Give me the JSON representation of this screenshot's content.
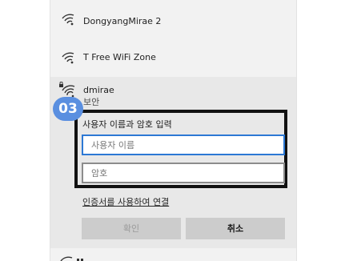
{
  "networks": [
    {
      "name": "DongyangMirae 2",
      "icon": "wifi-icon",
      "secured": false
    },
    {
      "name": "T Free WiFi Zone",
      "icon": "wifi-icon",
      "secured": false
    },
    {
      "name": "dmirae",
      "icon": "wifi-secured-icon",
      "secured": true,
      "status": "보안"
    }
  ],
  "step_badge": "03",
  "auth": {
    "prompt": "사용자 이름과 암호 입력",
    "username_placeholder": "사용자 이름",
    "username_value": "",
    "password_placeholder": "암호",
    "password_value": "",
    "cert_link": "인증서를 사용하여 연결",
    "ok_label": "확인",
    "cancel_label": "취소"
  },
  "colors": {
    "accent": "#2c78d4",
    "badge": "#5a8fe0",
    "highlight_box": "#111111"
  }
}
